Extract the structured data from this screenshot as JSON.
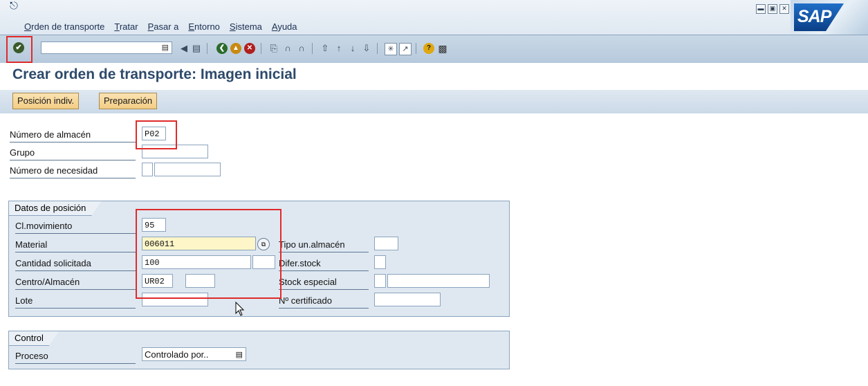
{
  "menu": [
    "Orden de transporte",
    "Tratar",
    "Pasar a",
    "Entorno",
    "Sistema",
    "Ayuda"
  ],
  "window_buttons": [
    "minimize",
    "maximize",
    "close"
  ],
  "logo": "SAP",
  "toolbar": {
    "command_value": "",
    "icons": [
      "enter-icon",
      "back-icon",
      "save-icon",
      "back-green-icon",
      "exit-icon",
      "cancel-icon",
      "print-icon",
      "find-icon",
      "find-next-icon",
      "first-page-icon",
      "prev-page-icon",
      "next-page-icon",
      "last-page-icon",
      "create-session-icon",
      "shortcut-icon",
      "help-icon",
      "layout-icon"
    ]
  },
  "title": "Crear orden de transporte: Imagen inicial",
  "app_buttons": {
    "single": "Posición indiv.",
    "prep": "Preparación"
  },
  "header_fields": {
    "warehouse_label": "Número de almacén",
    "warehouse_value": "P02",
    "group_label": "Grupo",
    "group_value": "",
    "requirement_label": "Número de necesidad",
    "requirement_type": "",
    "requirement_value": ""
  },
  "position": {
    "title": "Datos de posición",
    "movement_label": "Cl.movimiento",
    "movement_value": "95",
    "material_label": "Material",
    "material_value": "006011",
    "qty_label": "Cantidad solicitada",
    "qty_value": "100",
    "qty_unit": "",
    "plant_label": "Centro/Almacén",
    "plant_value": "UR02",
    "sloc_value": "",
    "batch_label": "Lote",
    "batch_value": "",
    "storage_type_label": "Tipo un.almacén",
    "storage_type_value": "",
    "stock_diff_label": "Difer.stock",
    "stock_diff_value": "",
    "special_stock_label": "Stock especial",
    "special_stock_value": "",
    "special_stock_value2": "",
    "certificate_label": "Nº certificado",
    "certificate_value": ""
  },
  "control": {
    "title": "Control",
    "process_label": "Proceso",
    "process_value": "Controlado por.."
  },
  "colors": {
    "highlight": "#e02a2a",
    "title": "#2d4a6b",
    "button": "#f3cd84"
  }
}
